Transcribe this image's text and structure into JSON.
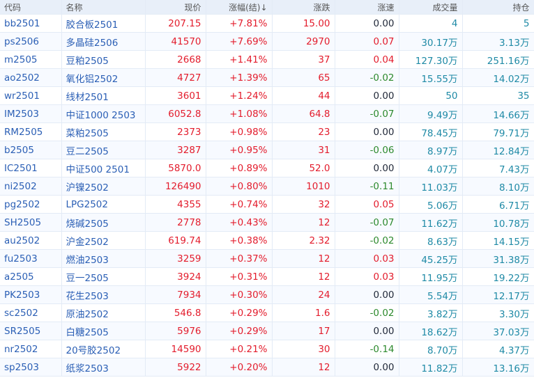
{
  "headers": [
    "代码",
    "名称",
    "现价",
    "涨幅(结)↓",
    "涨跌",
    "涨速",
    "成交量",
    "持仓"
  ],
  "colors": {
    "up": "#e31c2c",
    "down": "#2d8a2d",
    "flat": "#222a3a",
    "volume": "#1f8aa6",
    "link": "#2b5fb5"
  },
  "rows": [
    [
      "bb2501",
      "胶合板2501",
      "207.15",
      "+7.81%",
      "15.00",
      "0.00",
      "4",
      "5"
    ],
    [
      "ps2506",
      "多晶硅2506",
      "41570",
      "+7.69%",
      "2970",
      "0.07",
      "30.17万",
      "3.13万"
    ],
    [
      "m2505",
      "豆粕2505",
      "2668",
      "+1.41%",
      "37",
      "0.04",
      "127.30万",
      "251.16万"
    ],
    [
      "ao2502",
      "氧化铝2502",
      "4727",
      "+1.39%",
      "65",
      "-0.02",
      "15.55万",
      "14.02万"
    ],
    [
      "wr2501",
      "线材2501",
      "3601",
      "+1.24%",
      "44",
      "0.00",
      "50",
      "35"
    ],
    [
      "IM2503",
      "中证1000 2503",
      "6052.8",
      "+1.08%",
      "64.8",
      "-0.07",
      "9.49万",
      "14.66万"
    ],
    [
      "RM2505",
      "菜粕2505",
      "2373",
      "+0.98%",
      "23",
      "0.00",
      "78.45万",
      "79.71万"
    ],
    [
      "b2505",
      "豆二2505",
      "3287",
      "+0.95%",
      "31",
      "-0.06",
      "8.97万",
      "12.84万"
    ],
    [
      "IC2501",
      "中证500 2501",
      "5870.0",
      "+0.89%",
      "52.0",
      "0.00",
      "4.07万",
      "7.43万"
    ],
    [
      "ni2502",
      "沪镍2502",
      "126490",
      "+0.80%",
      "1010",
      "-0.11",
      "11.03万",
      "8.10万"
    ],
    [
      "pg2502",
      "LPG2502",
      "4355",
      "+0.74%",
      "32",
      "0.05",
      "5.06万",
      "6.71万"
    ],
    [
      "SH2505",
      "烧碱2505",
      "2778",
      "+0.43%",
      "12",
      "-0.07",
      "11.62万",
      "10.78万"
    ],
    [
      "au2502",
      "沪金2502",
      "619.74",
      "+0.38%",
      "2.32",
      "-0.02",
      "8.63万",
      "14.15万"
    ],
    [
      "fu2503",
      "燃油2503",
      "3259",
      "+0.37%",
      "12",
      "0.03",
      "45.25万",
      "31.38万"
    ],
    [
      "a2505",
      "豆一2505",
      "3924",
      "+0.31%",
      "12",
      "0.03",
      "11.95万",
      "19.22万"
    ],
    [
      "PK2503",
      "花生2503",
      "7934",
      "+0.30%",
      "24",
      "0.00",
      "5.54万",
      "12.17万"
    ],
    [
      "sc2502",
      "原油2502",
      "546.8",
      "+0.29%",
      "1.6",
      "-0.02",
      "3.82万",
      "3.30万"
    ],
    [
      "SR2505",
      "白糖2505",
      "5976",
      "+0.29%",
      "17",
      "0.00",
      "18.62万",
      "37.03万"
    ],
    [
      "nr2502",
      "20号胶2502",
      "14590",
      "+0.21%",
      "30",
      "-0.14",
      "8.70万",
      "4.37万"
    ],
    [
      "sp2503",
      "纸浆2503",
      "5922",
      "+0.20%",
      "12",
      "0.00",
      "11.82万",
      "13.16万"
    ]
  ]
}
